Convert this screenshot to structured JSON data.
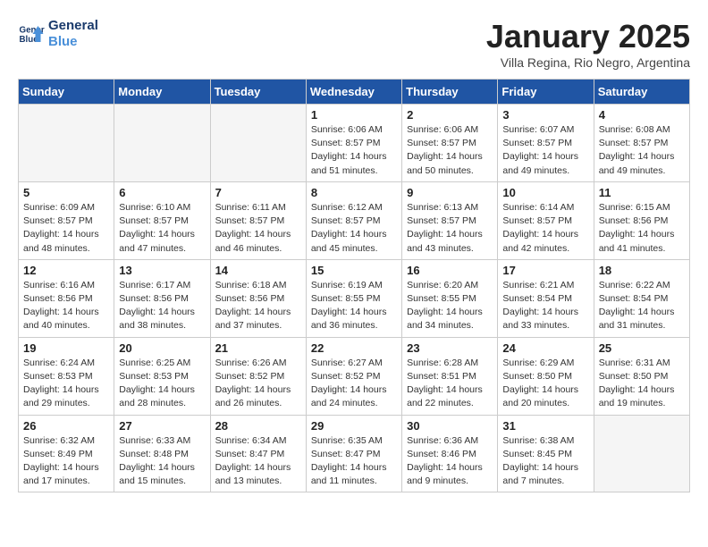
{
  "header": {
    "logo_line1": "General",
    "logo_line2": "Blue",
    "month": "January 2025",
    "location": "Villa Regina, Rio Negro, Argentina"
  },
  "days_of_week": [
    "Sunday",
    "Monday",
    "Tuesday",
    "Wednesday",
    "Thursday",
    "Friday",
    "Saturday"
  ],
  "weeks": [
    [
      {
        "day": "",
        "info": ""
      },
      {
        "day": "",
        "info": ""
      },
      {
        "day": "",
        "info": ""
      },
      {
        "day": "1",
        "info": "Sunrise: 6:06 AM\nSunset: 8:57 PM\nDaylight: 14 hours\nand 51 minutes."
      },
      {
        "day": "2",
        "info": "Sunrise: 6:06 AM\nSunset: 8:57 PM\nDaylight: 14 hours\nand 50 minutes."
      },
      {
        "day": "3",
        "info": "Sunrise: 6:07 AM\nSunset: 8:57 PM\nDaylight: 14 hours\nand 49 minutes."
      },
      {
        "day": "4",
        "info": "Sunrise: 6:08 AM\nSunset: 8:57 PM\nDaylight: 14 hours\nand 49 minutes."
      }
    ],
    [
      {
        "day": "5",
        "info": "Sunrise: 6:09 AM\nSunset: 8:57 PM\nDaylight: 14 hours\nand 48 minutes."
      },
      {
        "day": "6",
        "info": "Sunrise: 6:10 AM\nSunset: 8:57 PM\nDaylight: 14 hours\nand 47 minutes."
      },
      {
        "day": "7",
        "info": "Sunrise: 6:11 AM\nSunset: 8:57 PM\nDaylight: 14 hours\nand 46 minutes."
      },
      {
        "day": "8",
        "info": "Sunrise: 6:12 AM\nSunset: 8:57 PM\nDaylight: 14 hours\nand 45 minutes."
      },
      {
        "day": "9",
        "info": "Sunrise: 6:13 AM\nSunset: 8:57 PM\nDaylight: 14 hours\nand 43 minutes."
      },
      {
        "day": "10",
        "info": "Sunrise: 6:14 AM\nSunset: 8:57 PM\nDaylight: 14 hours\nand 42 minutes."
      },
      {
        "day": "11",
        "info": "Sunrise: 6:15 AM\nSunset: 8:56 PM\nDaylight: 14 hours\nand 41 minutes."
      }
    ],
    [
      {
        "day": "12",
        "info": "Sunrise: 6:16 AM\nSunset: 8:56 PM\nDaylight: 14 hours\nand 40 minutes."
      },
      {
        "day": "13",
        "info": "Sunrise: 6:17 AM\nSunset: 8:56 PM\nDaylight: 14 hours\nand 38 minutes."
      },
      {
        "day": "14",
        "info": "Sunrise: 6:18 AM\nSunset: 8:56 PM\nDaylight: 14 hours\nand 37 minutes."
      },
      {
        "day": "15",
        "info": "Sunrise: 6:19 AM\nSunset: 8:55 PM\nDaylight: 14 hours\nand 36 minutes."
      },
      {
        "day": "16",
        "info": "Sunrise: 6:20 AM\nSunset: 8:55 PM\nDaylight: 14 hours\nand 34 minutes."
      },
      {
        "day": "17",
        "info": "Sunrise: 6:21 AM\nSunset: 8:54 PM\nDaylight: 14 hours\nand 33 minutes."
      },
      {
        "day": "18",
        "info": "Sunrise: 6:22 AM\nSunset: 8:54 PM\nDaylight: 14 hours\nand 31 minutes."
      }
    ],
    [
      {
        "day": "19",
        "info": "Sunrise: 6:24 AM\nSunset: 8:53 PM\nDaylight: 14 hours\nand 29 minutes."
      },
      {
        "day": "20",
        "info": "Sunrise: 6:25 AM\nSunset: 8:53 PM\nDaylight: 14 hours\nand 28 minutes."
      },
      {
        "day": "21",
        "info": "Sunrise: 6:26 AM\nSunset: 8:52 PM\nDaylight: 14 hours\nand 26 minutes."
      },
      {
        "day": "22",
        "info": "Sunrise: 6:27 AM\nSunset: 8:52 PM\nDaylight: 14 hours\nand 24 minutes."
      },
      {
        "day": "23",
        "info": "Sunrise: 6:28 AM\nSunset: 8:51 PM\nDaylight: 14 hours\nand 22 minutes."
      },
      {
        "day": "24",
        "info": "Sunrise: 6:29 AM\nSunset: 8:50 PM\nDaylight: 14 hours\nand 20 minutes."
      },
      {
        "day": "25",
        "info": "Sunrise: 6:31 AM\nSunset: 8:50 PM\nDaylight: 14 hours\nand 19 minutes."
      }
    ],
    [
      {
        "day": "26",
        "info": "Sunrise: 6:32 AM\nSunset: 8:49 PM\nDaylight: 14 hours\nand 17 minutes."
      },
      {
        "day": "27",
        "info": "Sunrise: 6:33 AM\nSunset: 8:48 PM\nDaylight: 14 hours\nand 15 minutes."
      },
      {
        "day": "28",
        "info": "Sunrise: 6:34 AM\nSunset: 8:47 PM\nDaylight: 14 hours\nand 13 minutes."
      },
      {
        "day": "29",
        "info": "Sunrise: 6:35 AM\nSunset: 8:47 PM\nDaylight: 14 hours\nand 11 minutes."
      },
      {
        "day": "30",
        "info": "Sunrise: 6:36 AM\nSunset: 8:46 PM\nDaylight: 14 hours\nand 9 minutes."
      },
      {
        "day": "31",
        "info": "Sunrise: 6:38 AM\nSunset: 8:45 PM\nDaylight: 14 hours\nand 7 minutes."
      },
      {
        "day": "",
        "info": ""
      }
    ]
  ]
}
